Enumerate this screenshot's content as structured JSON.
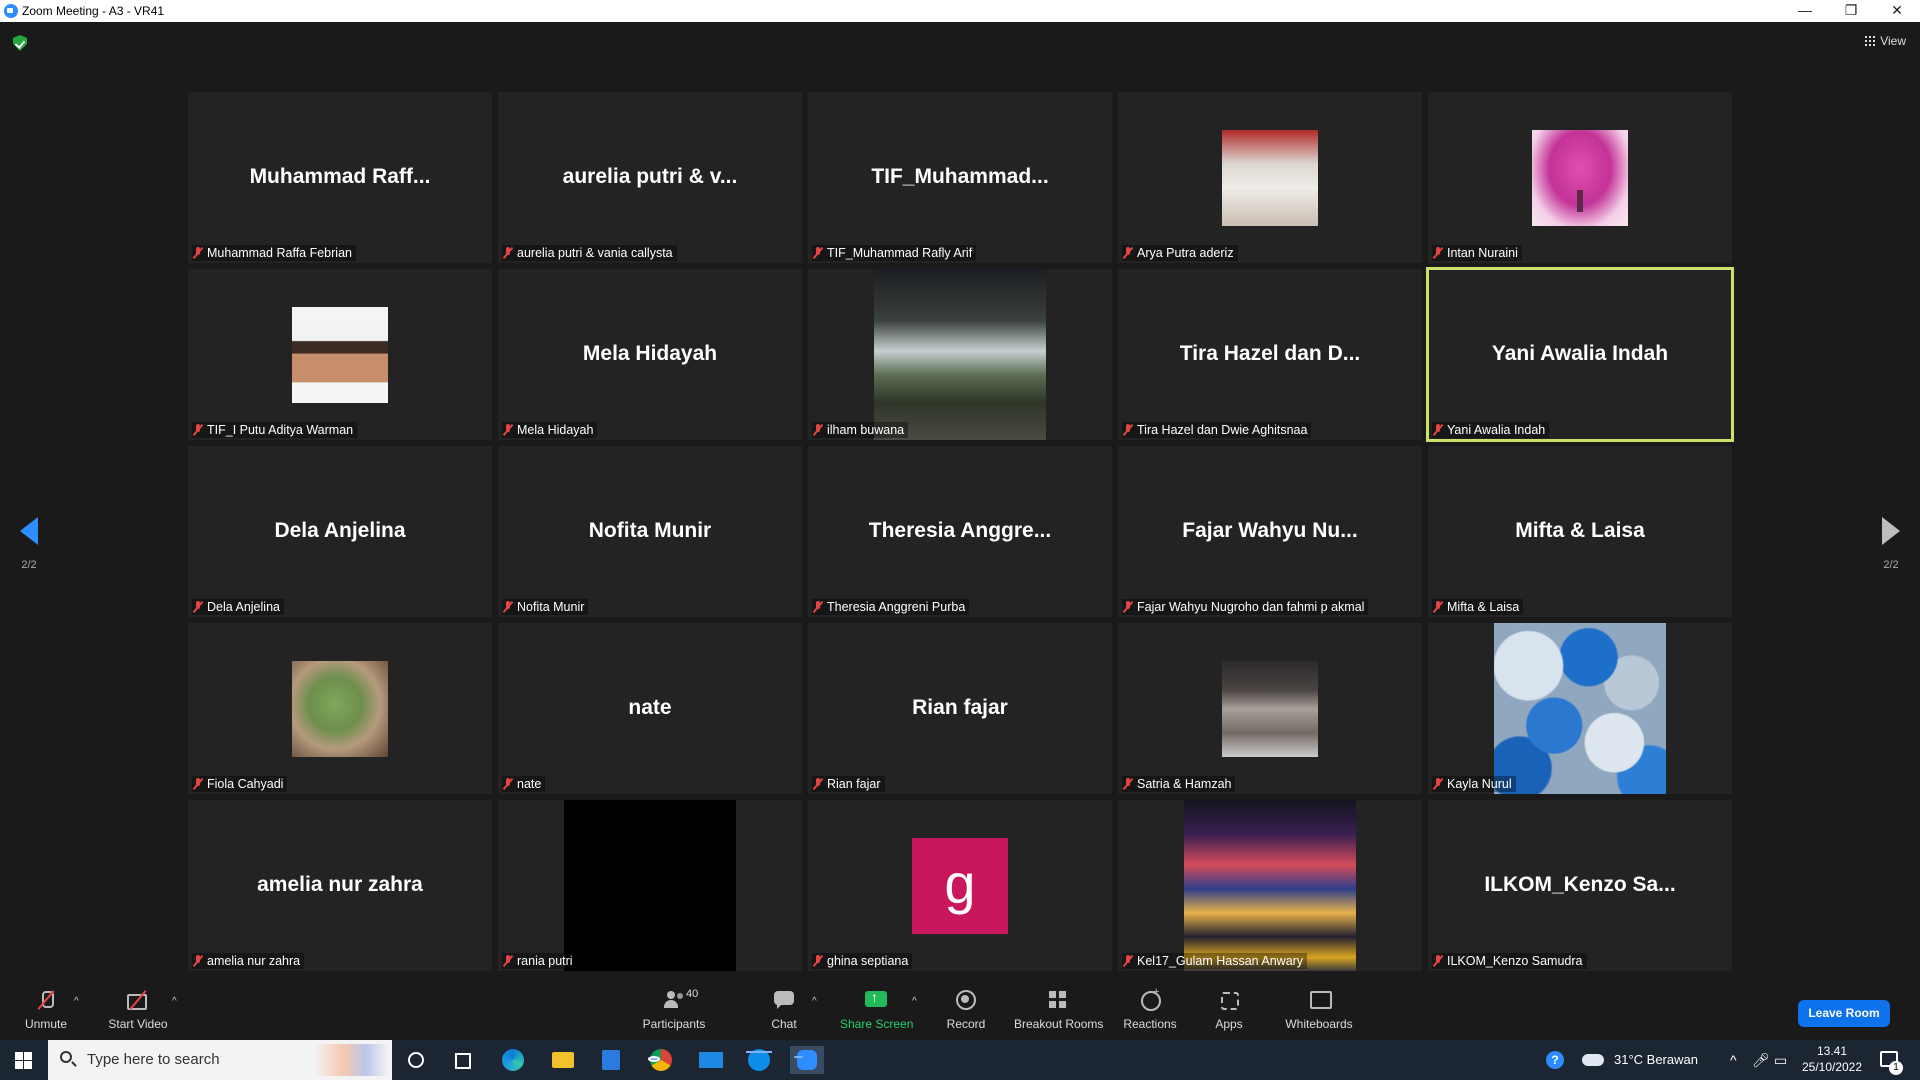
{
  "window": {
    "title": "Zoom Meeting - A3 - VR41",
    "minimize": "—",
    "maximize": "❐",
    "close": "✕"
  },
  "meeting": {
    "view_label": "View",
    "page_indicator_left": "2/2",
    "page_indicator_right": "2/2",
    "active_speaker_color": "#cfe06a",
    "tiles": [
      {
        "display_name": "Muhammad  Raff...",
        "label": "Muhammad Raffa Febrian",
        "video": "name-only"
      },
      {
        "display_name": "aurelia putri & v...",
        "label": "aurelia putri & vania callysta",
        "video": "name-only"
      },
      {
        "display_name": "TIF_Muhammad...",
        "label": "TIF_Muhammad Rafly Arif",
        "video": "name-only"
      },
      {
        "display_name": "",
        "label": "Arya Putra aderiz",
        "video": "profile-photo"
      },
      {
        "display_name": "",
        "label": "Intan Nuraini",
        "video": "profile-photo-pink-tree"
      },
      {
        "display_name": "",
        "label": "TIF_I Putu Aditya Warman",
        "video": "profile-photo-portrait"
      },
      {
        "display_name": "Mela Hidayah",
        "label": "Mela Hidayah",
        "video": "name-only"
      },
      {
        "display_name": "",
        "label": "ilham buwana",
        "video": "photo-night-scene"
      },
      {
        "display_name": "Tira Hazel dan D...",
        "label": "Tira Hazel dan Dwie Aghitsnaa",
        "video": "name-only"
      },
      {
        "display_name": "Yani Awalia Indah",
        "label": "Yani Awalia Indah",
        "video": "name-only",
        "active": true
      },
      {
        "display_name": "Dela Anjelina",
        "label": "Dela Anjelina",
        "video": "name-only"
      },
      {
        "display_name": "Nofita Munir",
        "label": "Nofita Munir",
        "video": "name-only"
      },
      {
        "display_name": "Theresia  Anggre...",
        "label": "Theresia Anggreni Purba",
        "video": "name-only"
      },
      {
        "display_name": "Fajar  Wahyu  Nu...",
        "label": "Fajar Wahyu Nugroho dan fahmi p akmal",
        "video": "name-only"
      },
      {
        "display_name": "Mifta & Laisa",
        "label": "Mifta & Laisa",
        "video": "name-only"
      },
      {
        "display_name": "",
        "label": "Fiola Cahyadi",
        "video": "profile-photo-yoda"
      },
      {
        "display_name": "nate",
        "label": "nate",
        "video": "name-only"
      },
      {
        "display_name": "Rian fajar",
        "label": "Rian fajar",
        "video": "name-only"
      },
      {
        "display_name": "",
        "label": "Satria & Hamzah",
        "video": "profile-photo-street"
      },
      {
        "display_name": "",
        "label": "Kayla Nurul",
        "video": "photo-balloons"
      },
      {
        "display_name": "amelia nur zahra",
        "label": "amelia nur zahra",
        "video": "name-only"
      },
      {
        "display_name": "",
        "label": "rania putri",
        "video": "black-video"
      },
      {
        "display_name": "",
        "label": "ghina septiana",
        "video": "initial-avatar",
        "initial": "g",
        "initial_color": "#c8175d"
      },
      {
        "display_name": "",
        "label": "Kel17_Gulam Hassan Anwary",
        "video": "photo-city-night"
      },
      {
        "display_name": "ILKOM_Kenzo  Sa...",
        "label": "ILKOM_Kenzo Samudra",
        "video": "name-only"
      }
    ]
  },
  "toolbar": {
    "unmute": "Unmute",
    "start_video": "Start Video",
    "participants": "Participants",
    "participants_count": "40",
    "chat": "Chat",
    "share_screen": "Share Screen",
    "record": "Record",
    "breakout_rooms": "Breakout Rooms",
    "reactions": "Reactions",
    "apps": "Apps",
    "whiteboards": "Whiteboards",
    "leave_room": "Leave Room",
    "caret": "^",
    "share_color": "#26d06b",
    "leave_color": "#0e72ed"
  },
  "taskbar": {
    "search_placeholder": "Type here to search",
    "weather": "31°C  Berawan",
    "time": "13.41",
    "date": "25/10/2022",
    "notification_count": "1",
    "help": "?",
    "tray_chevron": "^",
    "apps": [
      "cortana-icon",
      "task-view-icon",
      "edge-icon",
      "file-explorer-icon",
      "store-icon",
      "chrome-icon",
      "mail-icon",
      "teamviewer-icon",
      "zoom-icon"
    ]
  }
}
